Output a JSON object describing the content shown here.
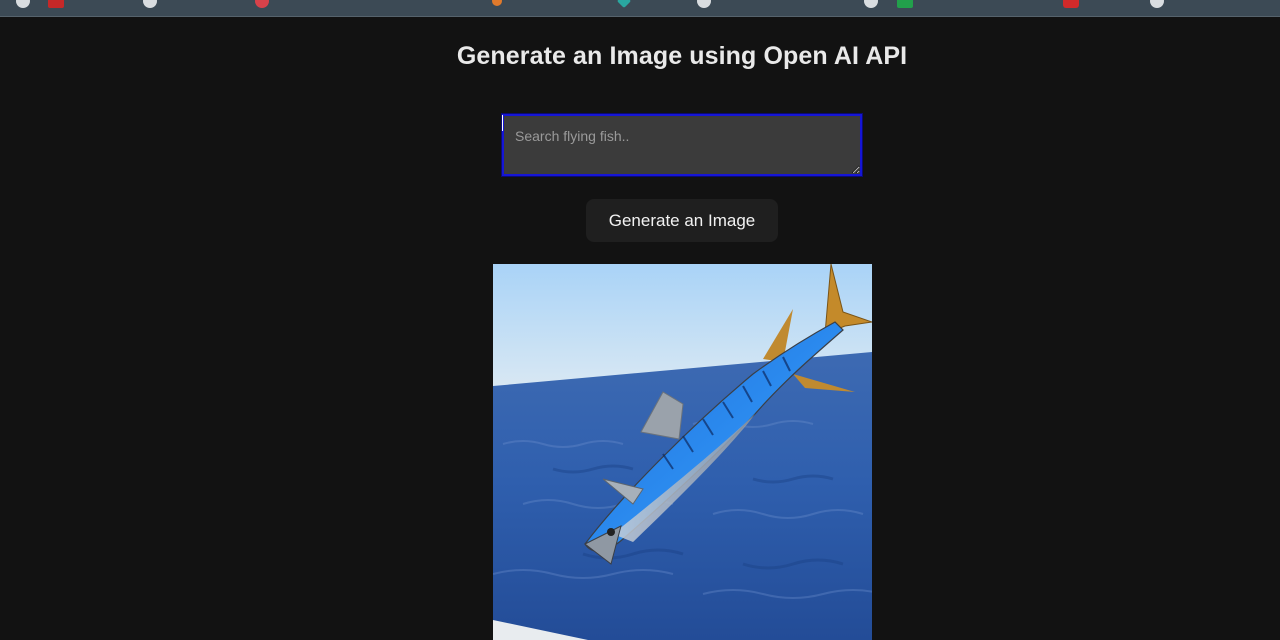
{
  "page": {
    "title": "Generate an Image using Open AI API"
  },
  "prompt": {
    "placeholder": "Search flying fish..",
    "value": ""
  },
  "generate_button": {
    "label": "Generate an Image"
  },
  "result_image": {
    "subject": "flying fish over ocean"
  },
  "colors": {
    "background": "#121212",
    "input_border": "#1515d6",
    "button_bg": "#1f1f1f",
    "title_text": "#e9e9e9"
  }
}
